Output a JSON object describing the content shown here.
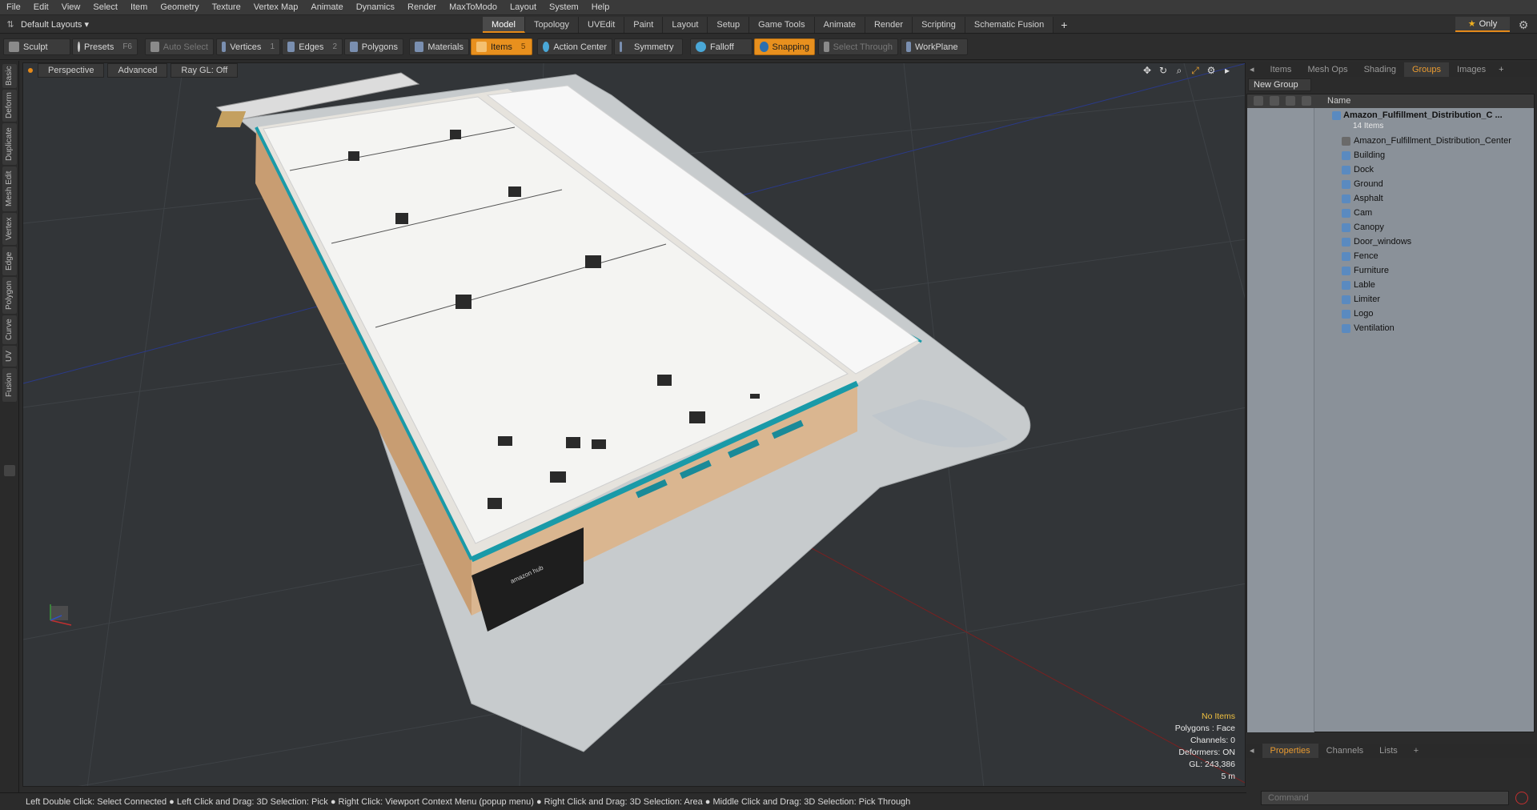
{
  "menu": [
    "File",
    "Edit",
    "View",
    "Select",
    "Item",
    "Geometry",
    "Texture",
    "Vertex Map",
    "Animate",
    "Dynamics",
    "Render",
    "MaxToModo",
    "Layout",
    "System",
    "Help"
  ],
  "layout": {
    "dropdown": "Default Layouts ▾"
  },
  "tabs": [
    {
      "label": "Model",
      "active": true
    },
    {
      "label": "Topology"
    },
    {
      "label": "UVEdit"
    },
    {
      "label": "Paint"
    },
    {
      "label": "Layout"
    },
    {
      "label": "Setup"
    },
    {
      "label": "Game Tools"
    },
    {
      "label": "Animate"
    },
    {
      "label": "Render"
    },
    {
      "label": "Scripting"
    },
    {
      "label": "Schematic Fusion"
    }
  ],
  "tabs_plus": "+",
  "only_label": "Only",
  "toolbar": {
    "sculpt": "Sculpt",
    "presets": "Presets",
    "presets_key": "F6",
    "auto_select": "Auto Select",
    "vertices": "Vertices",
    "vertices_count": "1",
    "edges": "Edges",
    "edges_count": "2",
    "polygons": "Polygons",
    "materials": "Materials",
    "items": "Items",
    "items_count": "5",
    "action_center": "Action Center",
    "symmetry": "Symmetry",
    "falloff": "Falloff",
    "snapping": "Snapping",
    "select_through": "Select Through",
    "workplane": "WorkPlane"
  },
  "left_tabs": [
    "Basic",
    "Deform",
    "Duplicate",
    "Mesh Edit",
    "Vertex",
    "Edge",
    "Polygon",
    "Curve",
    "UV",
    "Fusion"
  ],
  "viewport": {
    "perspective": "Perspective",
    "advanced": "Advanced",
    "raygl": "Ray GL: Off",
    "info": {
      "no_items": "No Items",
      "polygons": "Polygons : Face",
      "channels": "Channels: 0",
      "deformers": "Deformers: ON",
      "gl": "GL: 243,386",
      "scale": "5 m"
    },
    "roof_logo": "amazon hub"
  },
  "right_panel": {
    "tabs": [
      {
        "label": "Items"
      },
      {
        "label": "Mesh Ops"
      },
      {
        "label": "Shading"
      },
      {
        "label": "Groups",
        "active": true
      },
      {
        "label": "Images"
      }
    ],
    "tabs_plus": "+",
    "new_group": "New Group",
    "name_header": "Name",
    "root": {
      "name": "Amazon_Fulfillment_Distribution_C ...",
      "count": "14 Items"
    },
    "children": [
      "Amazon_Fulfillment_Distribution_Center",
      "Building",
      "Dock",
      "Ground",
      "Asphalt",
      "Cam",
      "Canopy",
      "Door_windows",
      "Fence",
      "Furniture",
      "Lable",
      "Limiter",
      "Logo",
      "Ventilation"
    ],
    "bottom_tabs": [
      {
        "label": "Properties",
        "active": true
      },
      {
        "label": "Channels"
      },
      {
        "label": "Lists"
      }
    ],
    "bottom_plus": "+",
    "command_placeholder": "Command"
  },
  "status_bar": "Left Double Click: Select Connected ● Left Click and Drag: 3D Selection: Pick ● Right Click: Viewport Context Menu (popup menu) ● Right Click and Drag: 3D Selection: Area ● Middle Click and Drag: 3D Selection: Pick Through",
  "colors": {
    "accent": "#e8901e",
    "teal": "#1a9aa8",
    "groups_bg": "#8a9199"
  },
  "icons": [
    "sculpt-icon",
    "presets-icon",
    "vertices-icon",
    "edges-icon",
    "polygons-icon",
    "materials-icon",
    "items-icon",
    "action-center-icon",
    "symmetry-icon",
    "falloff-icon",
    "snapping-icon",
    "workplane-icon",
    "star-icon",
    "gear-icon",
    "move-icon",
    "rotate-icon",
    "zoom-icon",
    "maximize-icon",
    "settings-icon",
    "play-icon",
    "eye-icon",
    "lock-icon",
    "group-icon",
    "mesh-icon",
    "stop-icon"
  ]
}
